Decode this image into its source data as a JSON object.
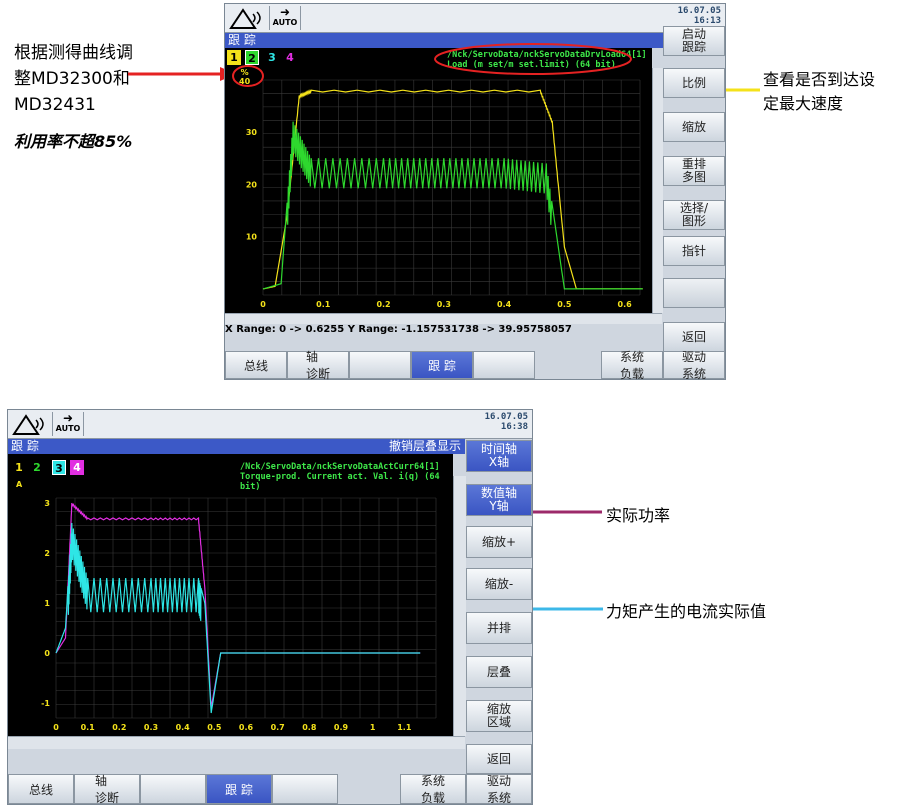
{
  "annotations": {
    "left_note_line1": "根据测得曲线调",
    "left_note_line2": "整MD32300和",
    "left_note_line3": "MD32431",
    "left_note_bold": "利用率不超85%",
    "right_note_1_line1": "查看是否到达设",
    "right_note_1_line2": "定最大速度",
    "right_note_2": "实际功率",
    "right_note_3": "力矩产生的电流实际值",
    "colors": {
      "red": "#e52222",
      "yellow": "#f4e21a",
      "purple": "#9c2a6a",
      "cyan": "#3cb8e8"
    }
  },
  "screen1": {
    "datetime_date": "16.07.05",
    "datetime_time": "16:13",
    "auto_label": "AUTO",
    "title": "跟 踪",
    "trace_numbers": [
      "1",
      "2",
      "3",
      "4"
    ],
    "signal_path": "/Nck/ServoData/nckServoDataDrvLoad64[1]",
    "signal_desc": "Load (m  set/m  set.limit) (64 bit)",
    "y_unit": "%",
    "y_top_label": "40",
    "range_text": "X Range: 0 -> 0.6255   Y Range: -1.157531738 -> 39.95758057",
    "softkeys": [
      "启动\n跟踪",
      "比例",
      "缩放",
      "重排\n多图",
      "选择/\n图形",
      "指针",
      "",
      "返回"
    ],
    "hkeys": [
      "总线",
      "轴\n诊断",
      "",
      "跟 踪",
      "",
      "系统\n负载",
      "驱动\n系统"
    ],
    "chart_data": {
      "type": "line",
      "x_ticks": [
        "0",
        "0.1",
        "0.2",
        "0.3",
        "0.4",
        "0.5",
        "0.6"
      ],
      "y_ticks": [
        "10",
        "20",
        "30"
      ],
      "xlim": [
        0,
        0.6255
      ],
      "ylim": [
        -1.157531738,
        39.95758057
      ],
      "series": [
        {
          "color": "#f4e21a",
          "x": [
            0,
            0.02,
            0.04,
            0.06,
            0.08,
            0.46,
            0.48,
            0.5,
            0.52,
            0.63
          ],
          "y": [
            0,
            0.5,
            14,
            37,
            38,
            38,
            32,
            8,
            0,
            0
          ]
        },
        {
          "color": "#2ed82e",
          "x": [
            0,
            0.03,
            0.05,
            0.08,
            0.2,
            0.3,
            0.4,
            0.47,
            0.5,
            0.63
          ],
          "y": [
            0,
            1,
            32,
            25,
            25,
            25,
            25,
            24,
            0,
            0
          ]
        }
      ]
    }
  },
  "screen2": {
    "datetime_date": "16.07.05",
    "datetime_time": "16:38",
    "auto_label": "AUTO",
    "title": "跟 踪",
    "title_right": "撤销层叠显示",
    "trace_numbers": [
      "1",
      "2",
      "3",
      "4"
    ],
    "signal_path": "/Nck/ServoData/nckServoDataActCurr64[1]",
    "signal_desc": "Torque-prod. Current act. Val. i(q) (64 bit)",
    "y_unit": "A",
    "softkeys": [
      "时间轴\nX轴",
      "数值轴\nY轴",
      "缩放+",
      "缩放-",
      "并排",
      "层叠",
      "缩放\n区域",
      "返回"
    ],
    "hkeys": [
      "总线",
      "轴\n诊断",
      "",
      "跟 踪",
      "",
      "系统\n负载",
      "驱动\n系统"
    ],
    "chart_data": {
      "type": "line",
      "x_ticks": [
        "0",
        "0.1",
        "0.2",
        "0.3",
        "0.4",
        "0.5",
        "0.6",
        "0.7",
        "0.8",
        "0.9",
        "1",
        "1.1"
      ],
      "y_ticks": [
        "3",
        "2",
        "1",
        "0",
        "-1"
      ],
      "xlim": [
        0,
        1.2
      ],
      "ylim": [
        -1.3,
        3.1
      ],
      "series": [
        {
          "color": "#e12ee1",
          "x": [
            0,
            0.03,
            0.05,
            0.1,
            0.3,
            0.45,
            0.47,
            0.49,
            0.52,
            1.15
          ],
          "y": [
            0,
            0.3,
            3.0,
            2.7,
            2.7,
            2.7,
            1.3,
            -1.1,
            0,
            0
          ]
        },
        {
          "color": "#2ee6e6",
          "x": [
            0,
            0.03,
            0.05,
            0.1,
            0.3,
            0.45,
            0.47,
            0.49,
            0.52,
            1.15
          ],
          "y": [
            0,
            0.5,
            2.6,
            1.5,
            1.5,
            1.5,
            1.0,
            -1.2,
            0,
            0
          ]
        }
      ]
    }
  }
}
